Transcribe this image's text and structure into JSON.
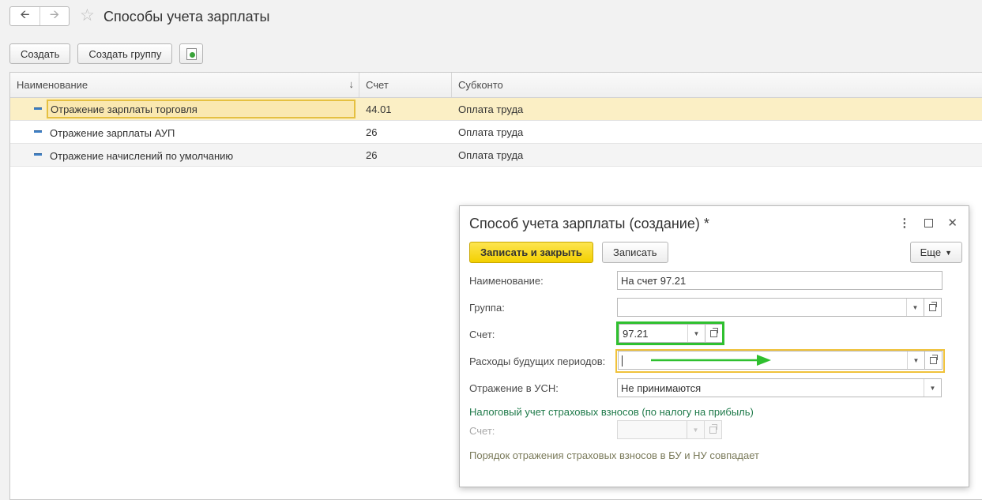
{
  "window": {
    "title": "Способы учета зарплаты"
  },
  "toolbar": {
    "create_label": "Создать",
    "create_group_label": "Создать группу"
  },
  "table": {
    "columns": [
      "Наименование",
      "Счет",
      "Субконто"
    ],
    "rows": [
      {
        "name": "Отражение зарплаты торговля",
        "account": "44.01",
        "subconto": "Оплата труда"
      },
      {
        "name": "Отражение зарплаты АУП",
        "account": "26",
        "subconto": "Оплата труда"
      },
      {
        "name": "Отражение начислений по умолчанию",
        "account": "26",
        "subconto": "Оплата труда"
      }
    ]
  },
  "dialog": {
    "title": "Способ учета зарплаты (создание) *",
    "save_close_label": "Записать и закрыть",
    "save_label": "Записать",
    "more_label": "Еще",
    "fields": {
      "name": {
        "label": "Наименование:",
        "value": "На счет 97.21"
      },
      "group": {
        "label": "Группа:",
        "value": ""
      },
      "account": {
        "label": "Счет:",
        "value": "97.21"
      },
      "deferred": {
        "label": "Расходы будущих периодов:",
        "value": ""
      },
      "usn": {
        "label": "Отражение в УСН:",
        "value": "Не принимаются"
      }
    },
    "tax_section_title": "Налоговый учет страховых взносов (по налогу на прибыль)",
    "tax_account_label": "Счет:",
    "tax_account_value": "",
    "note": "Порядок отражения страховых взносов в БУ и НУ совпадает"
  },
  "colors": {
    "primary_button": "#f3d000",
    "highlight_green": "#2fc02f",
    "highlight_yellow": "#f0c23b",
    "selected_row": "#fbefc5",
    "section_title": "#1f7a4a"
  }
}
